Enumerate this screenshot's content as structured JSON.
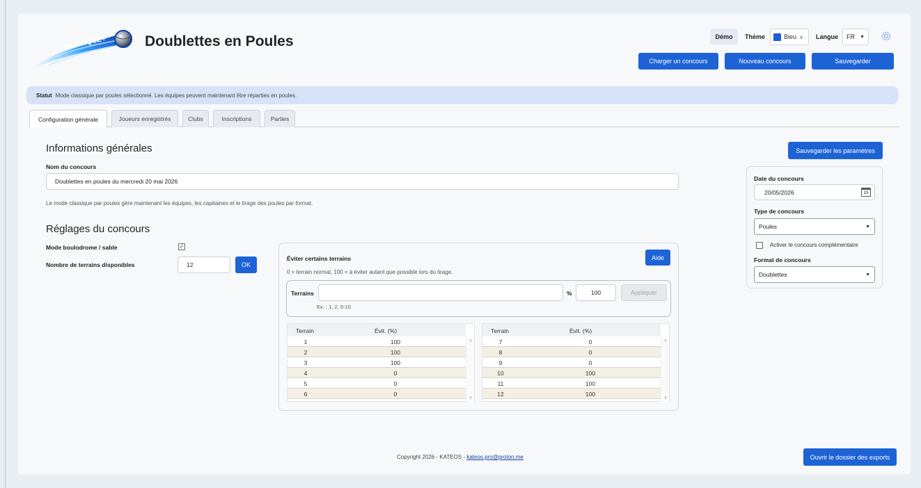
{
  "header": {
    "app_title": "Doublettes en Poules",
    "logo_text": "PÉTANQUE+",
    "demo_label": "Démo",
    "theme_label": "Thème",
    "theme_value": "Bleu",
    "theme_color": "#1d5fd8",
    "language_label": "Langue",
    "language_value": "FR",
    "buttons": {
      "load": "Charger un concours",
      "new": "Nouveau concours",
      "save": "Sauvegarder"
    }
  },
  "status": {
    "label": "Statut",
    "text": "Mode classique par poules sélectionné. Les équipes peuvent maintenant être réparties en poules."
  },
  "tabs": [
    {
      "label": "Configuration générale",
      "active": true
    },
    {
      "label": "Joueurs enregistrés",
      "active": false
    },
    {
      "label": "Clubs",
      "active": false
    },
    {
      "label": "Inscriptions",
      "active": false
    },
    {
      "label": "Parties",
      "active": false
    }
  ],
  "general": {
    "heading": "Informations générales",
    "name_label": "Nom du concours",
    "name_value": "Doublettes en poules du mercredi 20 mai 2026",
    "note": "Le mode classique par poules gère maintenant les équipes, les capitaines et le tirage des poules par format."
  },
  "settings": {
    "heading": "Réglages du concours",
    "boulodrome_label": "Mode boulodrome / sable",
    "boulodrome_checked": true,
    "fields_label": "Nombre de terrains disponibles",
    "fields_value": "12",
    "ok_label": "OK"
  },
  "avoid": {
    "title": "Éviter certains terrains",
    "help_label": "Aide",
    "hint": "0 = terrain normal, 100 = à éviter autant que possible lors du tirage.",
    "terrains_label": "Terrains",
    "terrains_value": "",
    "example": "Ex. : 1, 2, 5-10",
    "percent_label": "%",
    "percent_value": "100",
    "apply_label": "Appliquer",
    "col_terrain": "Terrain",
    "col_evit": "Évit. (%)",
    "left_rows": [
      {
        "terrain": "1",
        "evit": "100"
      },
      {
        "terrain": "2",
        "evit": "100"
      },
      {
        "terrain": "3",
        "evit": "100"
      },
      {
        "terrain": "4",
        "evit": "0"
      },
      {
        "terrain": "5",
        "evit": "0"
      },
      {
        "terrain": "6",
        "evit": "0"
      }
    ],
    "right_rows": [
      {
        "terrain": "7",
        "evit": "0"
      },
      {
        "terrain": "8",
        "evit": "0"
      },
      {
        "terrain": "9",
        "evit": "0"
      },
      {
        "terrain": "10",
        "evit": "100"
      },
      {
        "terrain": "11",
        "evit": "100"
      },
      {
        "terrain": "12",
        "evit": "100"
      }
    ]
  },
  "side": {
    "save_params_label": "Sauvegarder les paramètres",
    "date_label": "Date du concours",
    "date_value": "20/05/2026",
    "calendar_day": "15",
    "type_label": "Type de concours",
    "type_value": "Poules",
    "complement_label": "Activer le concours complémentaire",
    "complement_checked": false,
    "format_label": "Format de concours",
    "format_value": "Doublettes"
  },
  "footer": {
    "copyright": "Copyright 2026 - KATEOS - ",
    "email": "kateos.pro@proton.me",
    "export_label": "Ouvrir le dossier des exports"
  },
  "colors": {
    "primary": "#1e63d6",
    "status_bg": "#d6e2f6",
    "row_alt": "#f3efe4"
  }
}
